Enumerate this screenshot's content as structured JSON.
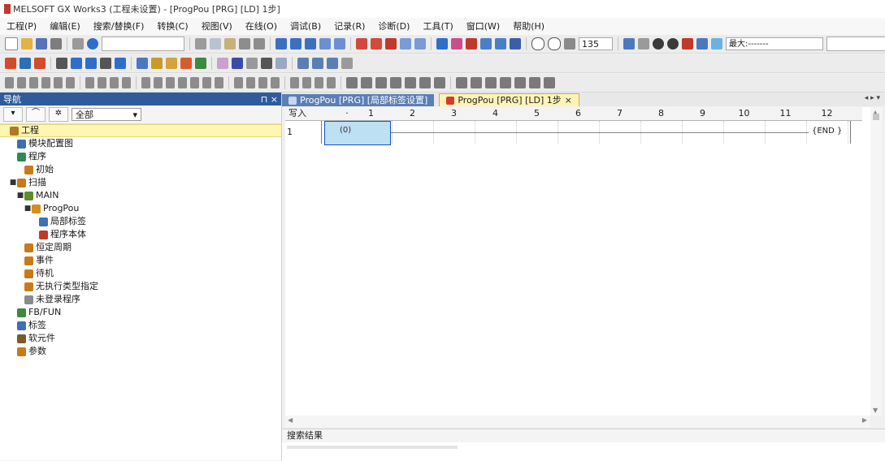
{
  "window": {
    "title": "MELSOFT GX Works3 (工程未设置) - [ProgPou [PRG] [LD] 1步]"
  },
  "menu": [
    "工程(P)",
    "编辑(E)",
    "搜索/替换(F)",
    "转换(C)",
    "视图(V)",
    "在线(O)",
    "调试(B)",
    "记录(R)",
    "诊断(D)",
    "工具(T)",
    "窗口(W)",
    "帮助(H)"
  ],
  "toolbar": {
    "zoom": "135",
    "network_combo": "最大:-------"
  },
  "nav": {
    "title": "导航",
    "filter": "全部",
    "tree": [
      {
        "label": "工程",
        "level": 0,
        "toggle": "",
        "icon": "project-icon",
        "color": "#b07a20",
        "selected": true
      },
      {
        "label": "模块配置图",
        "level": 1,
        "toggle": "",
        "icon": "module-config-icon",
        "color": "#3a6fb0"
      },
      {
        "label": "程序",
        "level": 1,
        "toggle": "",
        "icon": "program-icon",
        "color": "#2e8b57"
      },
      {
        "label": "初始",
        "level": 2,
        "toggle": "",
        "icon": "folder-icon",
        "color": "#c87a1a"
      },
      {
        "label": "扫描",
        "level": 1,
        "toggle": "■",
        "icon": "folder-icon",
        "color": "#c87a1a"
      },
      {
        "label": "MAIN",
        "level": 2,
        "toggle": "■",
        "icon": "main-program-icon",
        "color": "#5a8f2e"
      },
      {
        "label": "ProgPou",
        "level": 3,
        "toggle": "■",
        "icon": "pou-icon",
        "color": "#d98b1b"
      },
      {
        "label": "局部标签",
        "level": 4,
        "toggle": "",
        "icon": "local-label-icon",
        "color": "#3f6fb5"
      },
      {
        "label": "程序本体",
        "level": 4,
        "toggle": "",
        "icon": "program-body-icon",
        "color": "#c0392b"
      },
      {
        "label": "恒定周期",
        "level": 2,
        "toggle": "",
        "icon": "folder-icon",
        "color": "#c87a1a"
      },
      {
        "label": "事件",
        "level": 2,
        "toggle": "",
        "icon": "folder-icon",
        "color": "#c87a1a"
      },
      {
        "label": "待机",
        "level": 2,
        "toggle": "",
        "icon": "folder-icon",
        "color": "#c87a1a"
      },
      {
        "label": "无执行类型指定",
        "level": 2,
        "toggle": "",
        "icon": "folder-icon",
        "color": "#c87a1a"
      },
      {
        "label": "未登录程序",
        "level": 2,
        "toggle": "",
        "icon": "unregistered-icon",
        "color": "#8a8a8a"
      },
      {
        "label": "FB/FUN",
        "level": 1,
        "toggle": "",
        "icon": "fb-fun-icon",
        "color": "#3c8a3c"
      },
      {
        "label": "标签",
        "level": 1,
        "toggle": "",
        "icon": "label-icon",
        "color": "#3f6fb5"
      },
      {
        "label": "软元件",
        "level": 1,
        "toggle": "",
        "icon": "device-icon",
        "color": "#7a5b2b"
      },
      {
        "label": "参数",
        "level": 1,
        "toggle": "",
        "icon": "parameter-icon",
        "color": "#c87a1a"
      }
    ]
  },
  "tabs": [
    {
      "label": "ProgPou [PRG] [局部标签设置]",
      "active": false
    },
    {
      "label": "ProgPou [PRG] [LD] 1步",
      "active": true,
      "close": "×"
    }
  ],
  "ladder": {
    "write_label": "写入",
    "columns": [
      "1",
      "2",
      "3",
      "4",
      "5",
      "6",
      "7",
      "8",
      "9",
      "10",
      "11",
      "12"
    ],
    "rung": "1",
    "step": "(0)",
    "end_instruction": "{END }"
  },
  "search_panel": {
    "title": "搜索结果"
  }
}
